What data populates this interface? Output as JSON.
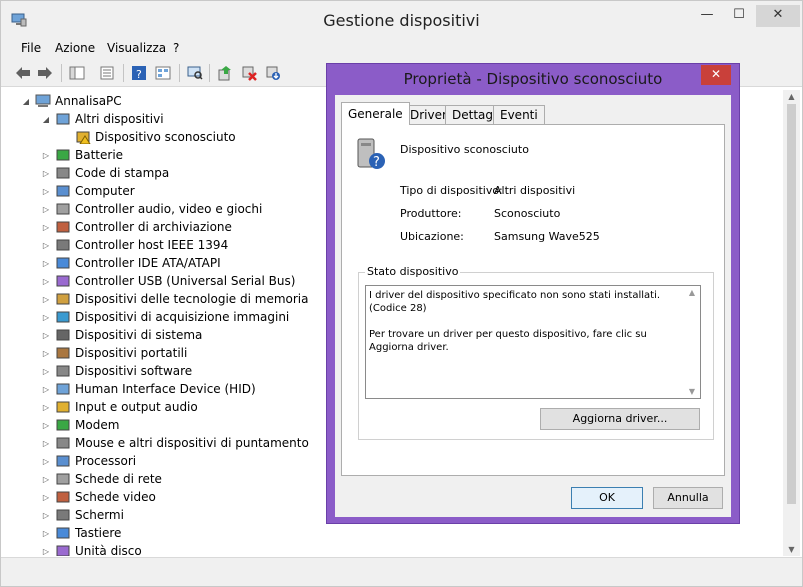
{
  "window": {
    "title": "Gestione dispositivi",
    "min_glyph": "—",
    "max_glyph": "☐",
    "close_glyph": "✕"
  },
  "menu": [
    "File",
    "Azione",
    "Visualizza",
    "?"
  ],
  "tree": {
    "root": "AnnalisaPC",
    "items": [
      {
        "label": "Altri dispositivi",
        "expanded": true,
        "icon": "unknown-device-icon"
      },
      {
        "label": "Dispositivo sconosciuto",
        "child": true,
        "icon": "warning-device-icon"
      },
      {
        "label": "Batterie",
        "icon": "battery-icon"
      },
      {
        "label": "Code di stampa",
        "icon": "printer-icon"
      },
      {
        "label": "Computer",
        "icon": "computer-icon"
      },
      {
        "label": "Controller audio, video e giochi",
        "icon": "speaker-icon"
      },
      {
        "label": "Controller di archiviazione",
        "icon": "storage-icon"
      },
      {
        "label": "Controller host IEEE 1394",
        "icon": "ieee1394-icon"
      },
      {
        "label": "Controller IDE ATA/ATAPI",
        "icon": "ide-icon"
      },
      {
        "label": "Controller USB (Universal Serial Bus)",
        "icon": "usb-icon"
      },
      {
        "label": "Dispositivi delle tecnologie di memoria",
        "icon": "memory-icon"
      },
      {
        "label": "Dispositivi di acquisizione immagini",
        "icon": "camera-icon"
      },
      {
        "label": "Dispositivi di sistema",
        "icon": "system-device-icon"
      },
      {
        "label": "Dispositivi portatili",
        "icon": "portable-device-icon"
      },
      {
        "label": "Dispositivi software",
        "icon": "software-device-icon"
      },
      {
        "label": "Human Interface Device (HID)",
        "icon": "hid-icon"
      },
      {
        "label": "Input e output audio",
        "icon": "audio-io-icon"
      },
      {
        "label": "Modem",
        "icon": "modem-icon"
      },
      {
        "label": "Mouse e altri dispositivi di puntamento",
        "icon": "mouse-icon"
      },
      {
        "label": "Processori",
        "icon": "processor-icon"
      },
      {
        "label": "Schede di rete",
        "icon": "network-icon"
      },
      {
        "label": "Schede video",
        "icon": "display-adapter-icon"
      },
      {
        "label": "Schermi",
        "icon": "monitor-icon"
      },
      {
        "label": "Tastiere",
        "icon": "keyboard-icon"
      },
      {
        "label": "Unità disco",
        "icon": "disk-icon"
      }
    ]
  },
  "dialog": {
    "title": "Proprietà - Dispositivo sconosciuto",
    "close_glyph": "✕",
    "tabs": [
      "Generale",
      "Driver",
      "Dettagli",
      "Eventi"
    ],
    "device_name": "Dispositivo sconosciuto",
    "properties": [
      {
        "label": "Tipo di dispositivo:",
        "value": "Altri dispositivi"
      },
      {
        "label": "Produttore:",
        "value": "Sconosciuto"
      },
      {
        "label": "Ubicazione:",
        "value": "Samsung Wave525"
      }
    ],
    "status_group_title": "Stato dispositivo",
    "status_text": "I driver del dispositivo specificato non sono stati installati. (Codice 28)\n\nPer trovare un driver per questo dispositivo, fare clic su Aggiorna driver.",
    "update_button": "Aggiorna driver...",
    "ok_button": "OK",
    "cancel_button": "Annulla"
  },
  "colors": {
    "dialog_frame": "#8b5cc8",
    "close_red": "#c9403a",
    "accent_blue": "#3c7fb1"
  }
}
